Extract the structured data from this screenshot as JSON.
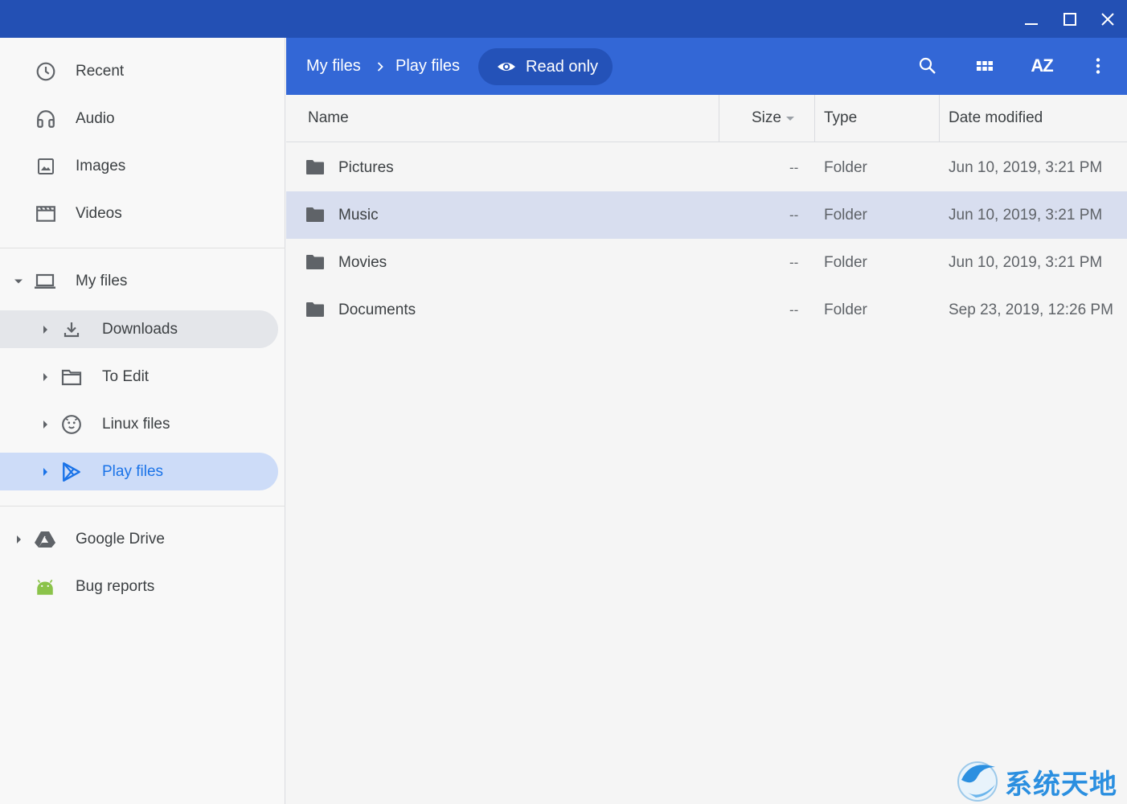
{
  "window": {
    "controls": [
      "minimize-icon",
      "maximize-icon",
      "close-icon"
    ],
    "titlebar_color": "#2350b4"
  },
  "sidebar": {
    "quick": [
      {
        "label": "Recent",
        "icon": "clock-icon"
      },
      {
        "label": "Audio",
        "icon": "headphones-icon"
      },
      {
        "label": "Images",
        "icon": "image-icon"
      },
      {
        "label": "Videos",
        "icon": "video-icon"
      }
    ],
    "my_files": {
      "label": "My files",
      "icon": "laptop-icon",
      "expanded": true,
      "children": [
        {
          "label": "Downloads",
          "icon": "download-icon",
          "state": "hover"
        },
        {
          "label": "To Edit",
          "icon": "folder-icon"
        },
        {
          "label": "Linux files",
          "icon": "linux-icon"
        },
        {
          "label": "Play files",
          "icon": "play-store-icon",
          "state": "selected"
        }
      ]
    },
    "others": [
      {
        "label": "Google Drive",
        "icon": "drive-icon"
      },
      {
        "label": "Bug reports",
        "icon": "android-icon"
      }
    ]
  },
  "toolbar": {
    "breadcrumb": [
      "My files",
      "Play files"
    ],
    "readonly_label": "Read only",
    "buttons": [
      "search-icon",
      "grid-view-icon",
      "sort-az-icon",
      "more-vert-icon"
    ],
    "sort_label": "AZ",
    "color": "#3367d6"
  },
  "table": {
    "columns": {
      "name": "Name",
      "size": "Size",
      "type": "Type",
      "date": "Date modified"
    },
    "rows": [
      {
        "name": "Pictures",
        "size": "--",
        "type": "Folder",
        "date": "Jun 10, 2019, 3:21 PM",
        "selected": false
      },
      {
        "name": "Music",
        "size": "--",
        "type": "Folder",
        "date": "Jun 10, 2019, 3:21 PM",
        "selected": true
      },
      {
        "name": "Movies",
        "size": "--",
        "type": "Folder",
        "date": "Jun 10, 2019, 3:21 PM",
        "selected": false
      },
      {
        "name": "Documents",
        "size": "--",
        "type": "Folder",
        "date": "Sep 23, 2019, 12:26 PM",
        "selected": false
      }
    ]
  },
  "watermark": {
    "text": "系统天地"
  }
}
